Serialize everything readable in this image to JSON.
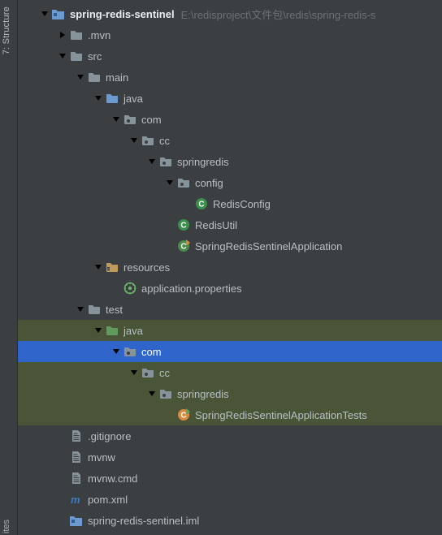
{
  "sideTabTop": "7: Structure",
  "sideTabBottom": "ites",
  "root": {
    "name": "spring-redis-sentinel",
    "path": "E:\\redisproject\\文件包\\redis\\spring-redis-s"
  },
  "nodes": {
    "mvn": ".mvn",
    "src": "src",
    "main": "main",
    "java": "java",
    "com": "com",
    "cc": "cc",
    "springredis": "springredis",
    "config": "config",
    "redisConfig": "RedisConfig",
    "redisUtil": "RedisUtil",
    "appClass": "SpringRedisSentinelApplication",
    "resources": "resources",
    "appProps": "application.properties",
    "test": "test",
    "javaTest": "java",
    "comTest": "com",
    "ccTest": "cc",
    "springredisTest": "springredis",
    "testsClass": "SpringRedisSentinelApplicationTests",
    "gitignore": ".gitignore",
    "mvnw": "mvnw",
    "mvnwCmd": "mvnw.cmd",
    "pom": "pom.xml",
    "iml": "spring-redis-sentinel.iml"
  }
}
